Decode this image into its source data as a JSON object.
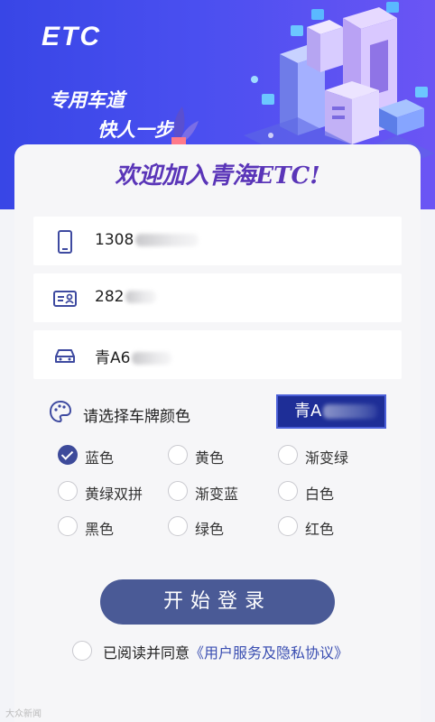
{
  "hero": {
    "logo": "ETC",
    "slogan_line1": "专用车道",
    "slogan_line2": "快人一步"
  },
  "welcome_title": "欢迎加入青海ETC!",
  "fields": {
    "phone_value": "1308",
    "id_value": "282",
    "plate_value": "青A6"
  },
  "plate_color": {
    "label": "请选择车牌颜色",
    "preview": "青A",
    "options": [
      {
        "label": "蓝色",
        "checked": true
      },
      {
        "label": "黄色",
        "checked": false
      },
      {
        "label": "渐变绿",
        "checked": false
      },
      {
        "label": "黄绿双拼",
        "checked": false
      },
      {
        "label": "渐变蓝",
        "checked": false
      },
      {
        "label": "白色",
        "checked": false
      },
      {
        "label": "黑色",
        "checked": false
      },
      {
        "label": "绿色",
        "checked": false
      },
      {
        "label": "红色",
        "checked": false
      }
    ]
  },
  "login_button": "开始登录",
  "agreement": {
    "prefix": "已阅读并同意",
    "link": "《用户服务及隐私协议》"
  },
  "watermark": "大众新闻",
  "colors": {
    "hero_blue": "#3846e6",
    "title_purple": "#5a35b8",
    "button": "#4a5a96",
    "checked": "#3d4a9a",
    "link": "#3b4fb2",
    "plate_blue": "#1e2e97"
  },
  "icons": [
    "phone-icon",
    "id-card-icon",
    "car-icon",
    "palette-icon",
    "check-icon"
  ]
}
